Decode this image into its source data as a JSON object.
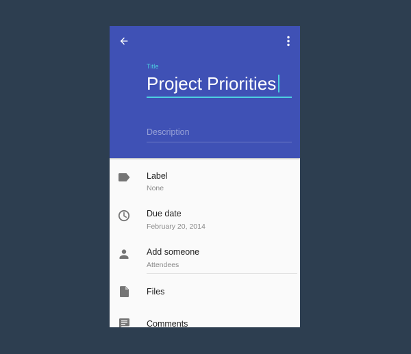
{
  "header": {
    "back_icon": "arrow-back-icon",
    "more_icon": "more-vert-icon",
    "title_label": "Title",
    "title_value": "Project Priorities",
    "description_placeholder": "Description",
    "colors": {
      "primary": "#3f51b5",
      "accent": "#4dd0e1",
      "background": "#2d3e50"
    }
  },
  "list": {
    "label": {
      "icon": "label-icon",
      "title": "Label",
      "value": "None"
    },
    "due_date": {
      "icon": "clock-icon",
      "title": "Due date",
      "value": "February 20, 2014"
    },
    "add_someone": {
      "icon": "person-icon",
      "title": "Add someone",
      "value": "Attendees"
    },
    "files": {
      "icon": "file-icon",
      "title": "Files"
    },
    "comments": {
      "icon": "comment-icon",
      "title": "Comments"
    }
  }
}
